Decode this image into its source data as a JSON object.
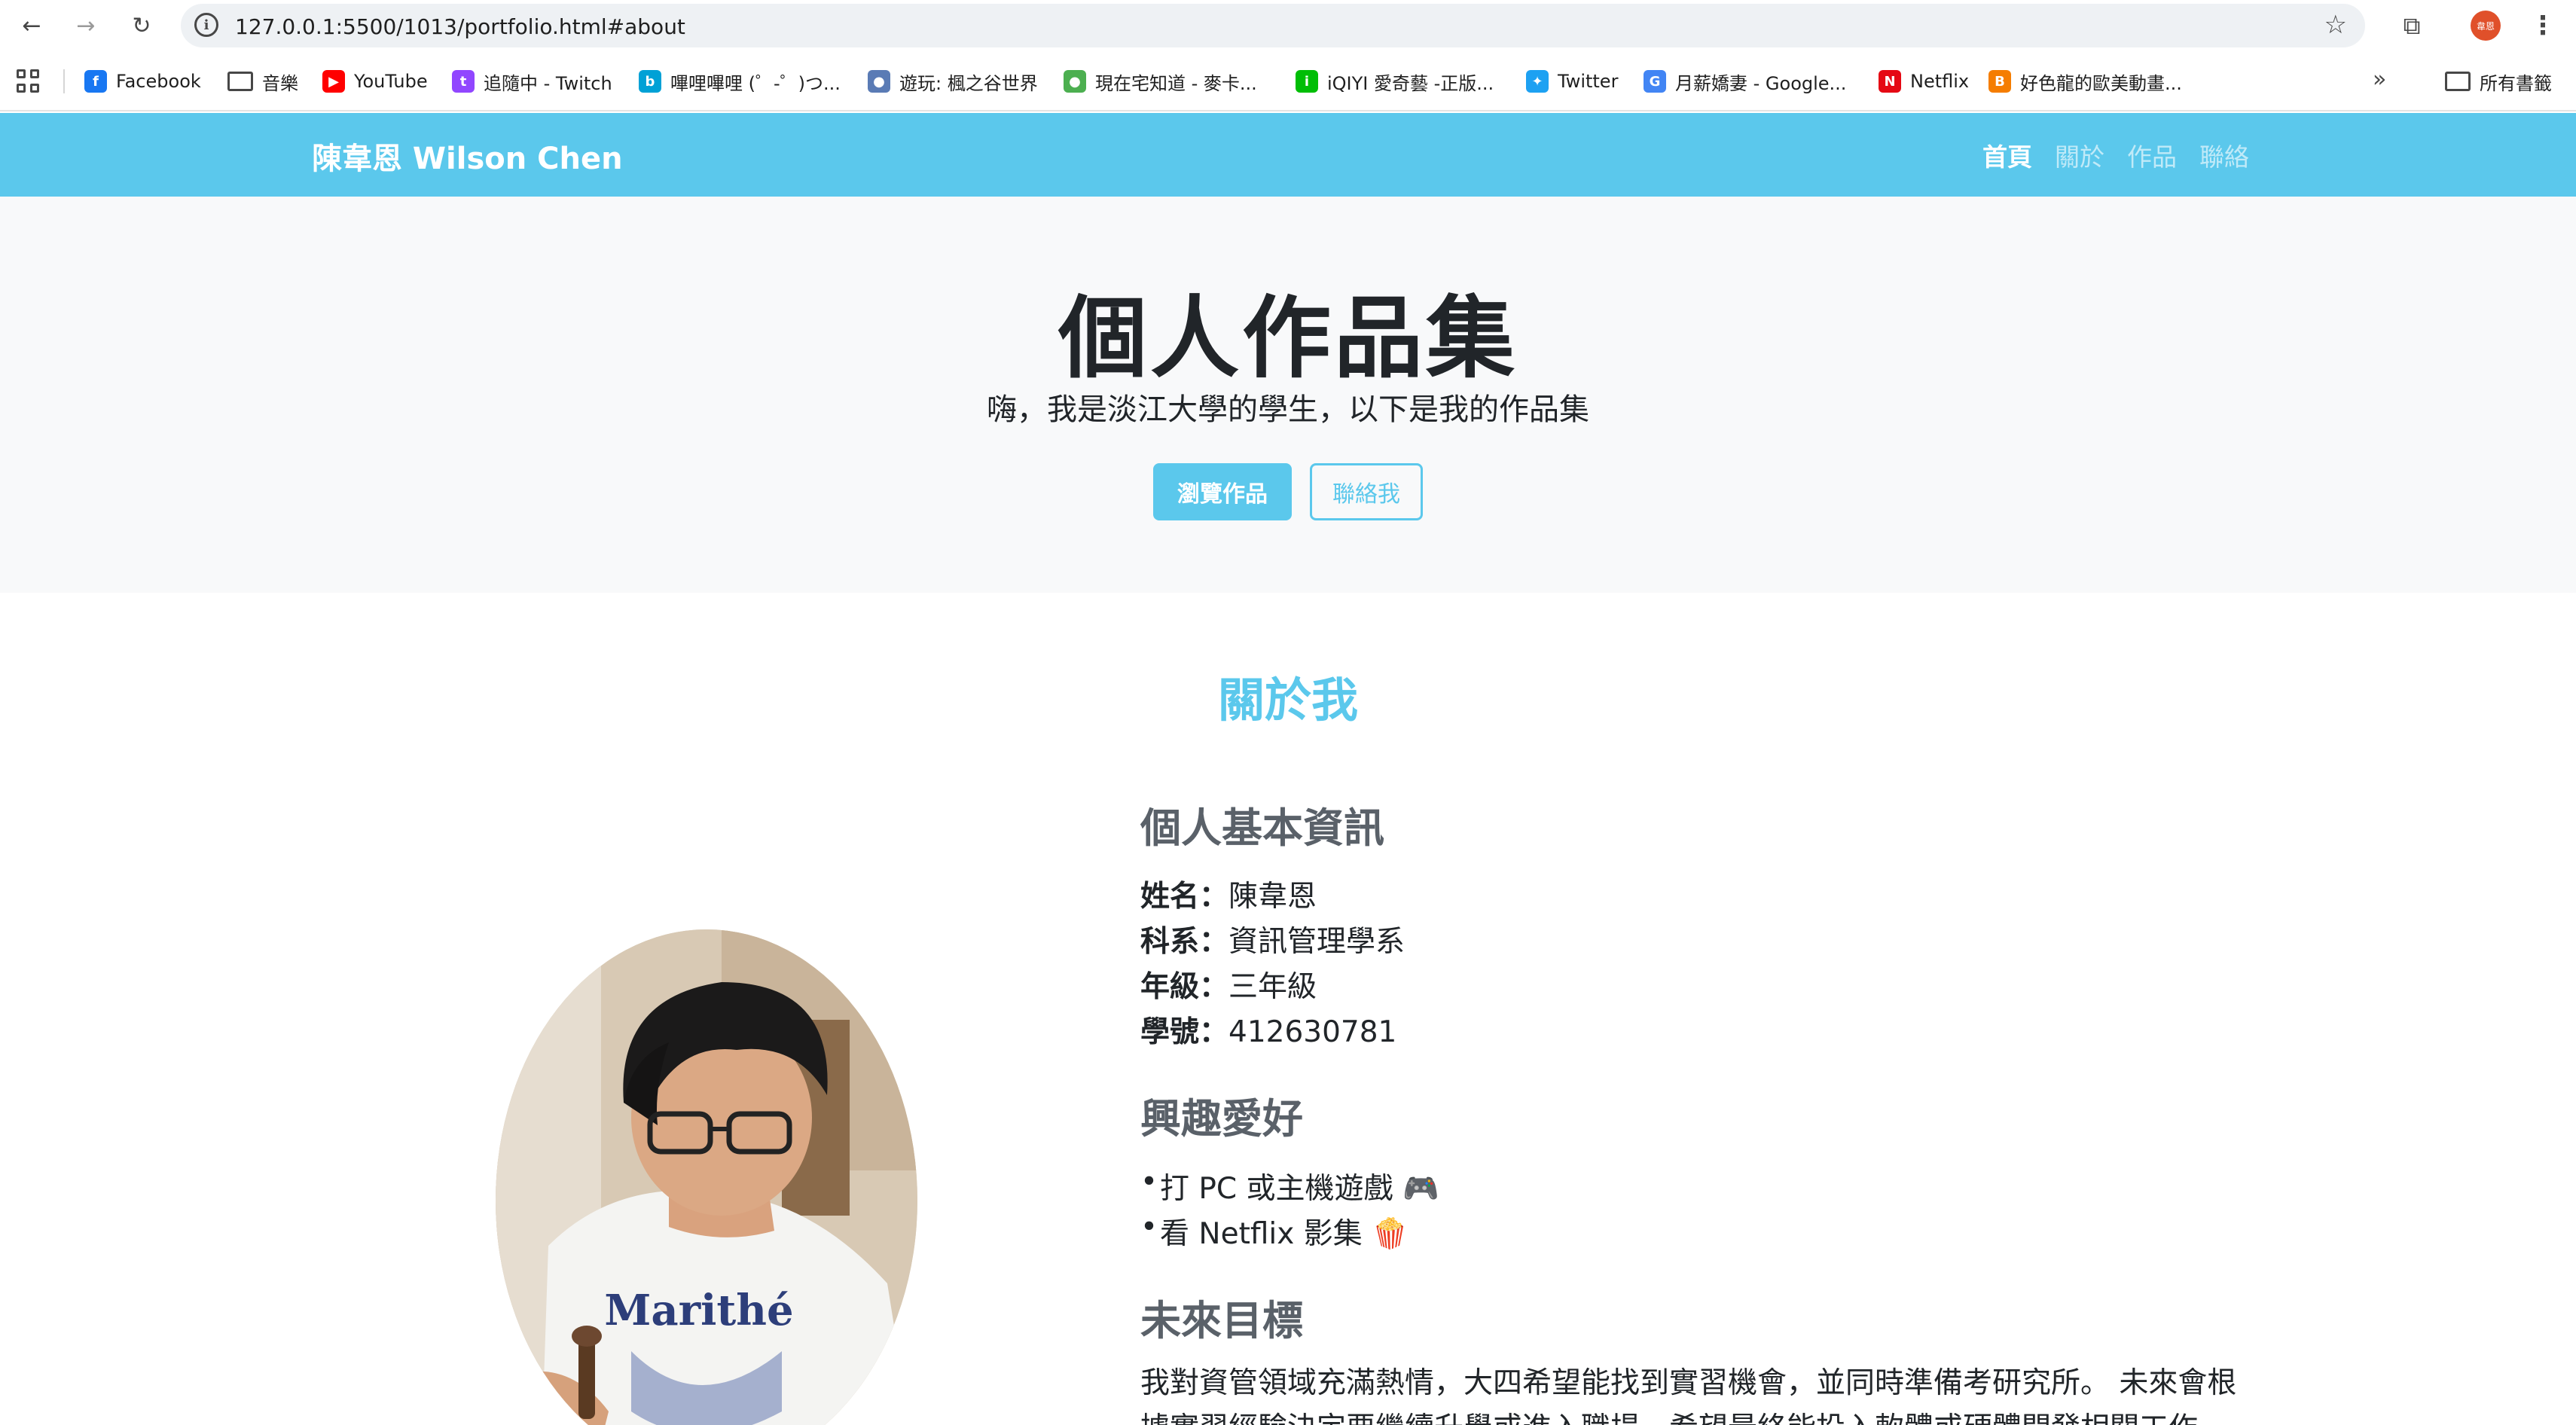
{
  "browser": {
    "url": "127.0.0.1:5500/1013/portfolio.html#about",
    "profile_label": "韋恩",
    "bookmarks": [
      {
        "label": "Facebook",
        "icon": "facebook-icon",
        "color": "#1877f2"
      },
      {
        "label": "音樂",
        "icon": "folder-icon",
        "color": "#474747"
      },
      {
        "label": "YouTube",
        "icon": "youtube-icon",
        "color": "#ff0000"
      },
      {
        "label": "追隨中 - Twitch",
        "icon": "twitch-icon",
        "color": "#9146ff"
      },
      {
        "label": "嗶哩嗶哩 (゜-゜)つ...",
        "icon": "bilibili-icon",
        "color": "#00a1d6"
      },
      {
        "label": "遊玩: 楓之谷世界",
        "icon": "maplestory-icon",
        "color": "#5a7bb5"
      },
      {
        "label": "現在宅知道 - 麥卡...",
        "icon": "mycard-icon",
        "color": "#4caf50"
      },
      {
        "label": "iQIYI 愛奇藝 -正版...",
        "icon": "iqiyi-icon",
        "color": "#00be06"
      },
      {
        "label": "Twitter",
        "icon": "twitter-icon",
        "color": "#1da1f2"
      },
      {
        "label": "月薪嬌妻 - Google...",
        "icon": "google-icon",
        "color": "#4285f4"
      },
      {
        "label": "Netflix",
        "icon": "netflix-icon",
        "color": "#e50914"
      },
      {
        "label": "好色龍的歐美動畫...",
        "icon": "blogger-icon",
        "color": "#f57d00"
      }
    ],
    "all_bookmarks": "所有書籤"
  },
  "navbar": {
    "brand": "陳韋恩 Wilson Chen",
    "links": [
      "首頁",
      "關於",
      "作品",
      "聯絡"
    ],
    "active_index": 0
  },
  "hero": {
    "title": "個人作品集",
    "subtitle": "嗨，我是淡江大學的學生，以下是我的作品集",
    "primary_button": "瀏覽作品",
    "secondary_button": "聯絡我"
  },
  "about": {
    "title": "關於我",
    "basic_heading": "個人基本資訊",
    "fields": [
      {
        "label": "姓名：",
        "value": "陳韋恩"
      },
      {
        "label": "科系：",
        "value": "資訊管理學系"
      },
      {
        "label": "年級：",
        "value": "三年級"
      },
      {
        "label": "學號：",
        "value": "412630781"
      }
    ],
    "hobbies_heading": "興趣愛好",
    "hobbies": [
      "打 PC 或主機遊戲 🎮",
      "看 Netflix 影集 🍿"
    ],
    "goals_heading": "未來目標",
    "goals_text": "我對資管領域充滿熱情，大四希望能找到實習機會，並同時準備考研究所。 未來會根據實習經驗決定要繼續升學或進入職場，希望最終能投入軟體或硬體開發相關工作。",
    "photo_shirt_text": "Marithé"
  },
  "colors": {
    "accent": "#5bc8ec",
    "hero_bg": "#f8f9fa",
    "heading_gray": "#5a6169"
  }
}
